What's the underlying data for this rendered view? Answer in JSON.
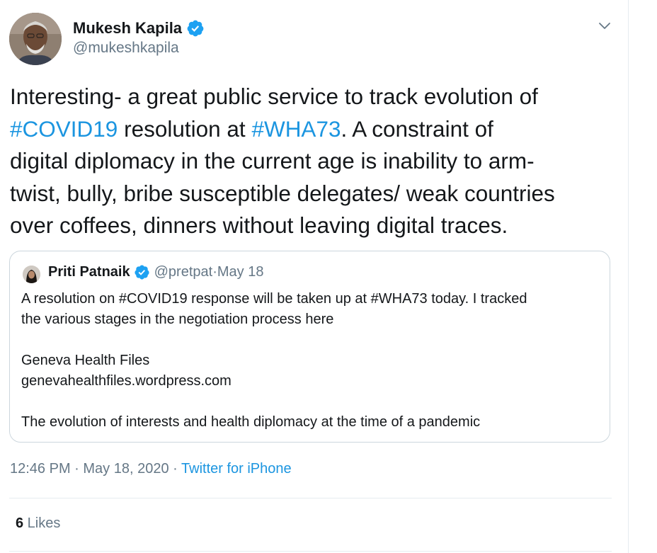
{
  "author": {
    "name": "Mukesh Kapila",
    "handle": "@mukeshkapila",
    "avatar_icon": "user-avatar-photo",
    "verified": true
  },
  "tweet": {
    "lines": [
      [
        {
          "t": "Interesting- a great public service to track evolution of",
          "tag": false
        }
      ],
      [
        {
          "t": "#COVID19",
          "tag": true
        },
        {
          "t": " resolution at ",
          "tag": false
        },
        {
          "t": "#WHA73",
          "tag": true
        },
        {
          "t": ".  A constraint of",
          "tag": false
        }
      ],
      [
        {
          "t": "digital diplomacy in the current age is inability to arm-",
          "tag": false
        }
      ],
      [
        {
          "t": "twist, bully, bribe susceptible delegates/ weak countries",
          "tag": false
        }
      ],
      [
        {
          "t": "over coffees, dinners without leaving digital traces.",
          "tag": false
        }
      ]
    ]
  },
  "quoted_tweet": {
    "name": "Priti Patnaik",
    "handle": "@pretpat",
    "separator": " · ",
    "date": "May 18",
    "verified": true,
    "body_lines": [
      "A resolution on #COVID19 response will be taken up at #WHA73 today. I tracked",
      "the various stages in the negotiation process here",
      "",
      "Geneva Health Files",
      "genevahealthfiles.wordpress.com",
      "",
      "The evolution of interests and health diplomacy at the time of a pandemic"
    ]
  },
  "meta": {
    "time": "12:46 PM",
    "sep1": " · ",
    "date": "May 18, 2020",
    "sep2": " · ",
    "source": "Twitter for iPhone"
  },
  "stats": {
    "likes_count": "6",
    "likes_label": " Likes"
  },
  "colors": {
    "link": "#1b95e0",
    "secondary_text": "#657786",
    "border": "#ccd6dd",
    "verified_badge": "#1da1f2"
  }
}
